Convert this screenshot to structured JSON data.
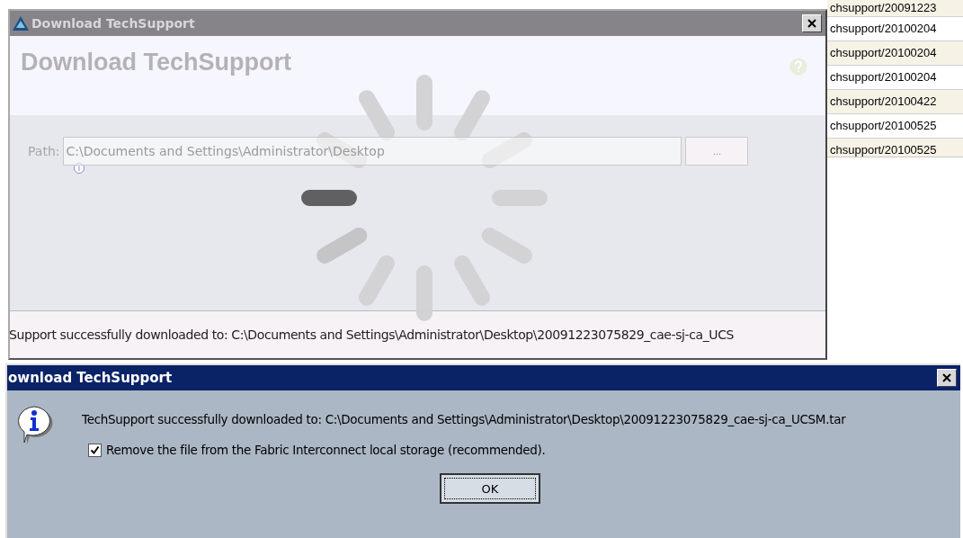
{
  "background_window": {
    "title": "Download TechSupport",
    "heading": "Download TechSupport",
    "path_label": "Path:",
    "path_value": "C:\\Documents and Settings\\Administrator\\Desktop",
    "browse_button": "...",
    "busy": true,
    "status": "Support successfully downloaded to: C:\\Documents and Settings\\Administrator\\Desktop\\20091223075829_cae-sj-ca_UCS"
  },
  "file_list": {
    "rows": [
      {
        "text": "chsupport/20091223"
      },
      {
        "text": "chsupport/20100204"
      },
      {
        "text": "chsupport/20100204"
      },
      {
        "text": "chsupport/20100204"
      },
      {
        "text": "chsupport/20100422"
      },
      {
        "text": "chsupport/20100525"
      },
      {
        "text": "chsupport/20100525"
      }
    ]
  },
  "message_dialog": {
    "title": "ownload TechSupport",
    "message": "TechSupport successfully downloaded to: C:\\Documents and Settings\\Administrator\\Desktop\\20091223075829_cae-sj-ca_UCSM.tar",
    "checkbox": {
      "label": "Remove the file from the Fabric Interconnect local storage (recommended).",
      "checked": true
    },
    "buttons": [
      "OK"
    ]
  }
}
